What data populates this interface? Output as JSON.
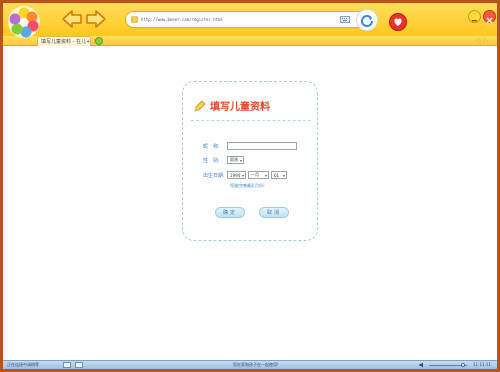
{
  "browser": {
    "address": "http://www.beeer.com/register.html",
    "tab_label": "填写儿童资料 - 在儿+",
    "tab_close": "×"
  },
  "form": {
    "title": "填写儿童资料",
    "name_label": "昵　称:",
    "name_value": "",
    "gender_label": "性　别:",
    "gender_value": "男孩",
    "birth_label": "出生日期:",
    "birth_year": "1994",
    "birth_month": "一月",
    "birth_day": "01",
    "hint": "（您能完善最近月份）",
    "submit_label": "确定",
    "cancel_label": "取消"
  },
  "statusbar": {
    "left_text": "正在连接中请稍等",
    "mid_text": "您在家和孩子在一起使用!",
    "volume": 0.9,
    "time": "11:11:11"
  },
  "colors": {
    "accent": "#ffc71e",
    "frame": "#b5541c",
    "title": "#e04a2a",
    "label": "#3b86c8"
  }
}
